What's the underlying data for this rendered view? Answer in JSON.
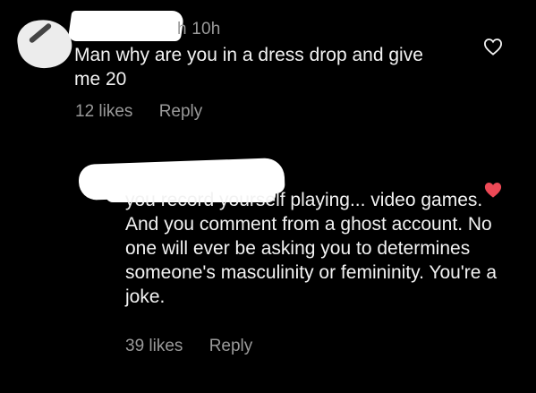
{
  "comments": [
    {
      "timestamp_fragment": "h 10h",
      "text": "Man why are you in a dress drop and give me 20",
      "likes": "12 likes",
      "reply_label": "Reply",
      "liked": false,
      "heart_icon": "heart-outline-icon"
    },
    {
      "text": "you record yourself playing... video games. And you comment from a ghost account. No one will ever be asking you to determines someone's masculinity or femininity. You're a joke.",
      "likes": "39 likes",
      "reply_label": "Reply",
      "liked": true,
      "heart_icon": "heart-filled-icon",
      "heart_color": "#ed4956"
    }
  ]
}
